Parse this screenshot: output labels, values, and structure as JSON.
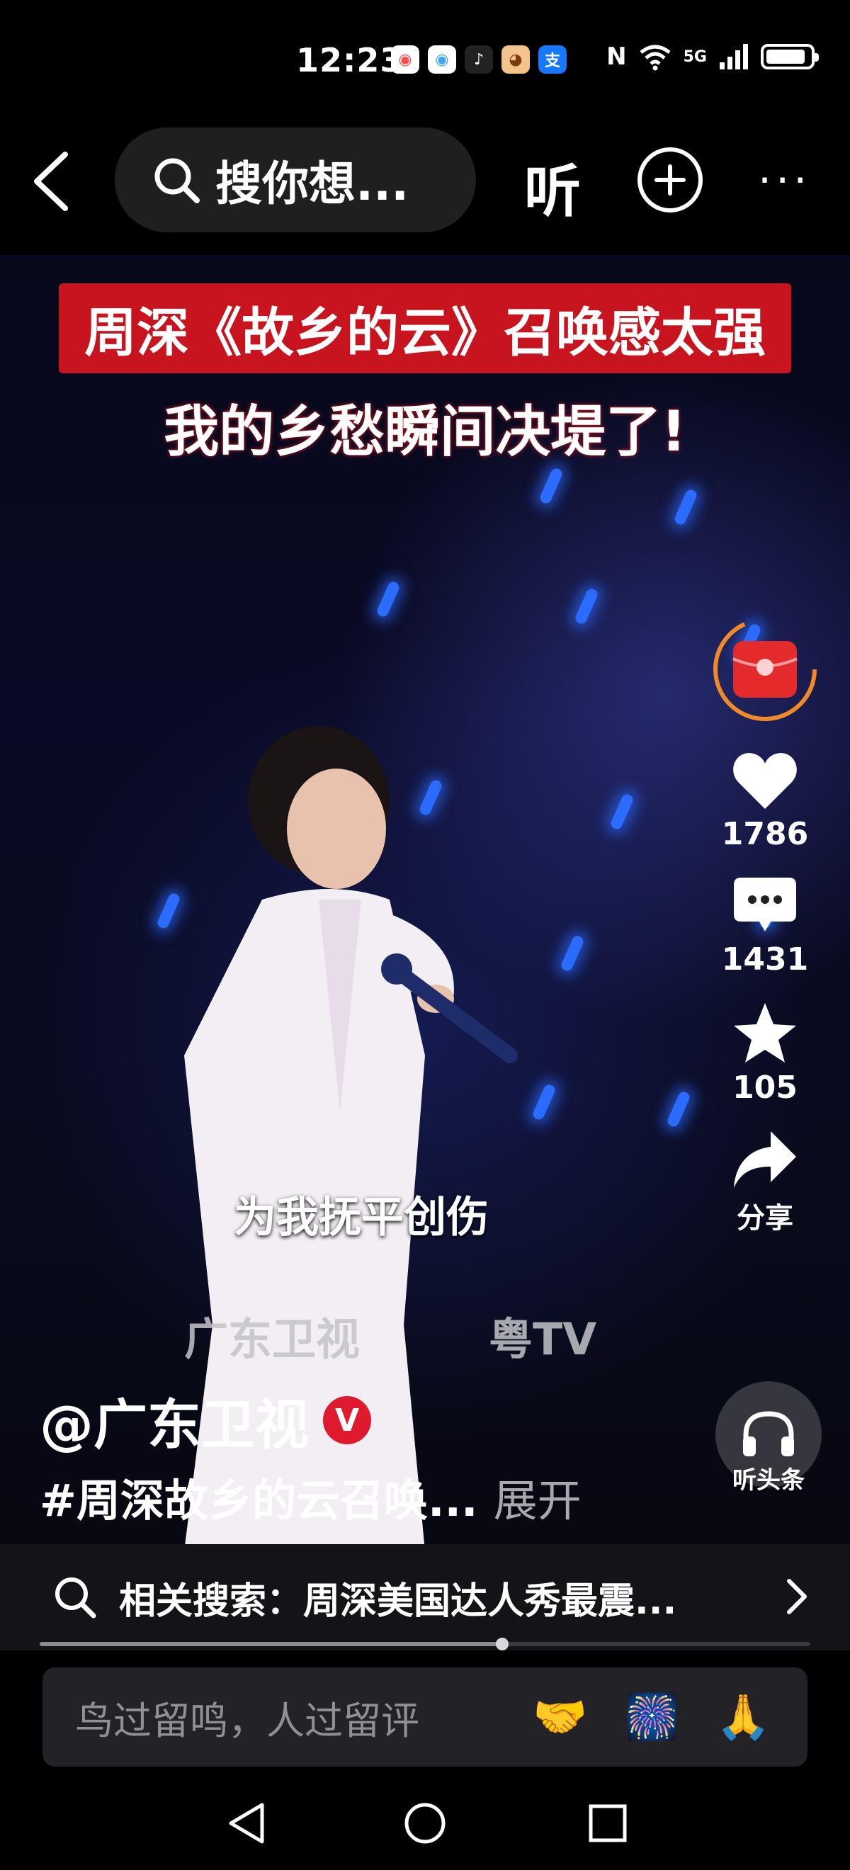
{
  "status_bar": {
    "time": "12:23",
    "apps": [
      {
        "icon": "app-icon-1",
        "color": "#ff4a4a"
      },
      {
        "icon": "app-icon-2",
        "color": "#3aa6ff"
      },
      {
        "icon": "tiktok-icon",
        "color": "#111111"
      },
      {
        "icon": "app-icon-4",
        "color": "#e59b4a"
      },
      {
        "icon": "alipay-icon",
        "color": "#1677ff"
      }
    ],
    "nfc": "N",
    "network": "5G",
    "battery_level": 0.9
  },
  "header": {
    "search_placeholder": "搜你想...",
    "listen_label": "听",
    "more_label": "···"
  },
  "video": {
    "headline_line1": "周深《故乡的云》召唤感太强",
    "headline_line2": "我的乡愁瞬间决堤了!",
    "lyric": "为我抚平创伤",
    "logo_left": "广东卫视",
    "logo_right": "粤TV"
  },
  "actions": {
    "likes": "1786",
    "comments": "1431",
    "favorites": "105",
    "share_label": "分享",
    "listen_card_label": "听头条"
  },
  "post": {
    "author": "@广东卫视",
    "verified_mark": "V",
    "caption": "#周深故乡的云召唤...",
    "expand_label": "展开"
  },
  "related": {
    "text": "相关搜索：周深美国达人秀最震..."
  },
  "playback": {
    "progress": 0.6
  },
  "comment": {
    "placeholder": "鸟过留鸣，人过留评",
    "emojis": [
      "🤝",
      "🎆",
      "🙏"
    ]
  },
  "colors": {
    "accent_red": "#c8141e",
    "verified_red": "#e01a2e",
    "glow_blue": "#2b6cff"
  }
}
